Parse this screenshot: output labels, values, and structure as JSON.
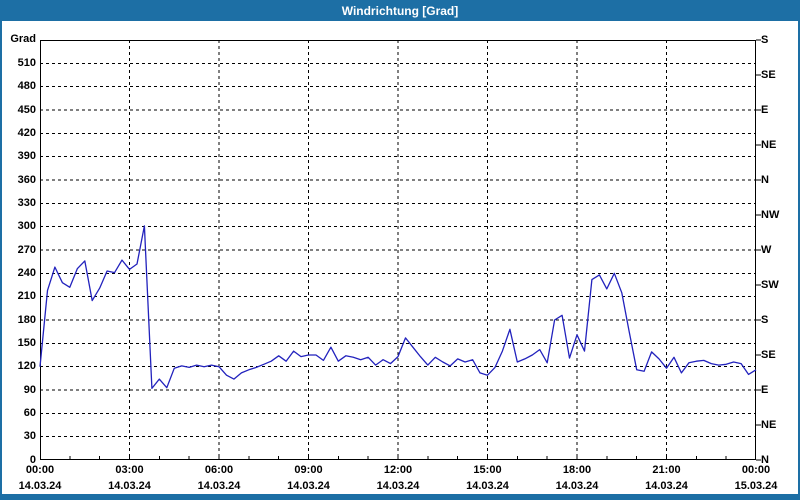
{
  "window": {
    "title": "Windrichtung [Grad]"
  },
  "colors": {
    "titlebar_bg": "#1d6fa5",
    "window_border": "#1d6fa5",
    "title_text": "#ffffff",
    "plot_bg": "#ffffff",
    "grid": "#000000",
    "axis_text": "#000000",
    "line": "#2222bd"
  },
  "chart_data": {
    "type": "line",
    "title": "Windrichtung [Grad]",
    "grid": {
      "horizontal_step_deg": 30,
      "vertical_step_hours": 3,
      "style": "dashed"
    },
    "y_axis_left": {
      "title": "Grad",
      "min": 0,
      "max": 540,
      "tick_step": 30,
      "tick_labels": [
        510,
        480,
        450,
        420,
        390,
        360,
        330,
        300,
        270,
        240,
        210,
        180,
        150,
        120,
        90,
        60,
        30,
        0
      ]
    },
    "y_axis_right": {
      "tick_step_deg": 45,
      "ticks": [
        {
          "deg": 540,
          "label": "S"
        },
        {
          "deg": 495,
          "label": "SE"
        },
        {
          "deg": 450,
          "label": "E"
        },
        {
          "deg": 405,
          "label": "NE"
        },
        {
          "deg": 360,
          "label": "N"
        },
        {
          "deg": 315,
          "label": "NW"
        },
        {
          "deg": 270,
          "label": "W"
        },
        {
          "deg": 225,
          "label": "SW"
        },
        {
          "deg": 180,
          "label": "S"
        },
        {
          "deg": 135,
          "label": "SE"
        },
        {
          "deg": 90,
          "label": "E"
        },
        {
          "deg": 45,
          "label": "NE"
        },
        {
          "deg": 0,
          "label": "N"
        }
      ]
    },
    "x_axis": {
      "min_hour": 0,
      "max_hour": 24,
      "major_tick_hours": 3,
      "minor_tick_hours": 1,
      "ticks": [
        {
          "hour": 0,
          "time": "00:00",
          "date": "14.03.24"
        },
        {
          "hour": 3,
          "time": "03:00",
          "date": "14.03.24"
        },
        {
          "hour": 6,
          "time": "06:00",
          "date": "14.03.24"
        },
        {
          "hour": 9,
          "time": "09:00",
          "date": "14.03.24"
        },
        {
          "hour": 12,
          "time": "12:00",
          "date": "14.03.24"
        },
        {
          "hour": 15,
          "time": "15:00",
          "date": "14.03.24"
        },
        {
          "hour": 18,
          "time": "18:00",
          "date": "14.03.24"
        },
        {
          "hour": 21,
          "time": "21:00",
          "date": "14.03.24"
        },
        {
          "hour": 24,
          "time": "00:00",
          "date": "15.03.24"
        }
      ]
    },
    "series": [
      {
        "name": "Windrichtung",
        "color": "#2222bd",
        "points": [
          [
            0,
            120
          ],
          [
            0.25,
            218
          ],
          [
            0.5,
            248
          ],
          [
            0.75,
            228
          ],
          [
            1,
            222
          ],
          [
            1.25,
            246
          ],
          [
            1.5,
            256
          ],
          [
            1.75,
            205
          ],
          [
            2,
            221
          ],
          [
            2.25,
            243
          ],
          [
            2.5,
            241
          ],
          [
            2.75,
            257
          ],
          [
            3,
            245
          ],
          [
            3.25,
            252
          ],
          [
            3.5,
            301
          ],
          [
            3.75,
            92
          ],
          [
            4,
            104
          ],
          [
            4.25,
            93
          ],
          [
            4.5,
            118
          ],
          [
            4.75,
            121
          ],
          [
            5,
            119
          ],
          [
            5.25,
            122
          ],
          [
            5.5,
            120
          ],
          [
            5.75,
            122
          ],
          [
            6,
            120
          ],
          [
            6.25,
            109
          ],
          [
            6.5,
            104
          ],
          [
            6.75,
            112
          ],
          [
            7,
            116
          ],
          [
            7.25,
            119
          ],
          [
            7.5,
            123
          ],
          [
            7.75,
            127
          ],
          [
            8,
            134
          ],
          [
            8.25,
            127
          ],
          [
            8.5,
            140
          ],
          [
            8.75,
            133
          ],
          [
            9,
            135
          ],
          [
            9.25,
            135
          ],
          [
            9.5,
            128
          ],
          [
            9.75,
            145
          ],
          [
            10,
            127
          ],
          [
            10.25,
            134
          ],
          [
            10.5,
            132
          ],
          [
            10.75,
            129
          ],
          [
            11,
            132
          ],
          [
            11.25,
            122
          ],
          [
            11.5,
            129
          ],
          [
            11.75,
            124
          ],
          [
            12,
            133
          ],
          [
            12.25,
            157
          ],
          [
            12.5,
            145
          ],
          [
            12.75,
            133
          ],
          [
            13,
            122
          ],
          [
            13.25,
            132
          ],
          [
            13.5,
            126
          ],
          [
            13.75,
            121
          ],
          [
            14,
            130
          ],
          [
            14.25,
            126
          ],
          [
            14.5,
            129
          ],
          [
            14.75,
            112
          ],
          [
            15,
            109
          ],
          [
            15.25,
            119
          ],
          [
            15.5,
            140
          ],
          [
            15.75,
            168
          ],
          [
            16,
            126
          ],
          [
            16.25,
            130
          ],
          [
            16.5,
            135
          ],
          [
            16.75,
            142
          ],
          [
            17,
            125
          ],
          [
            17.25,
            180
          ],
          [
            17.5,
            186
          ],
          [
            17.75,
            131
          ],
          [
            18,
            161
          ],
          [
            18.25,
            140
          ],
          [
            18.5,
            232
          ],
          [
            18.75,
            238
          ],
          [
            19,
            220
          ],
          [
            19.25,
            240
          ],
          [
            19.5,
            215
          ],
          [
            19.75,
            165
          ],
          [
            20,
            116
          ],
          [
            20.25,
            114
          ],
          [
            20.5,
            139
          ],
          [
            20.75,
            130
          ],
          [
            21,
            118
          ],
          [
            21.25,
            132
          ],
          [
            21.5,
            112
          ],
          [
            21.75,
            125
          ],
          [
            22,
            127
          ],
          [
            22.25,
            128
          ],
          [
            22.5,
            124
          ],
          [
            22.75,
            122
          ],
          [
            23,
            123
          ],
          [
            23.25,
            126
          ],
          [
            23.5,
            124
          ],
          [
            23.75,
            110
          ],
          [
            24,
            116
          ]
        ]
      }
    ]
  }
}
